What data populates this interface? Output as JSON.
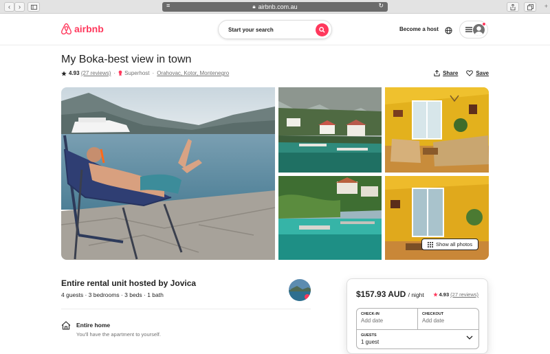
{
  "browser": {
    "url": "airbnb.com.au",
    "back_icon": "chevron-left-icon",
    "forward_icon": "chevron-right-icon"
  },
  "header": {
    "brand": "airbnb",
    "search_label": "Start your search",
    "host_label": "Become a host",
    "brand_color": "#ff385c"
  },
  "listing": {
    "title": "My Boka-best view in town",
    "rating": "4.93",
    "reviews": "(27 reviews)",
    "superhost": "Superhost",
    "location": "Orahovac, Kotor, Montenegro",
    "share_label": "Share",
    "save_label": "Save",
    "show_all_label": "Show all photos"
  },
  "details": {
    "heading": "Entire rental unit hosted by Jovica",
    "summary": "4 guests · 3 bedrooms · 3 beds · 1 bath",
    "highlight_title": "Entire home",
    "highlight_sub": "You'll have the apartment to yourself."
  },
  "booking": {
    "price": "$157.93 AUD",
    "per_night": "/ night",
    "rating": "4.93",
    "reviews": "(27 reviews)",
    "checkin_label": "CHECK-IN",
    "checkin_value": "Add date",
    "checkout_label": "CHECKOUT",
    "checkout_value": "Add date",
    "guests_label": "GUESTS",
    "guests_value": "1 guest"
  }
}
